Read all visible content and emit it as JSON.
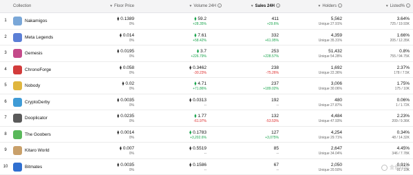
{
  "header": {
    "collection": "Collection",
    "floor": "Floor Price",
    "volume": "Volume 24H",
    "sales": "Sales 24H",
    "holders": "Holders",
    "listed": "Listed%"
  },
  "rows": [
    {
      "rank": "1",
      "name": "Nakamigos",
      "avatar_color": "#7aa7d8",
      "floor": "0.1389",
      "floor_chg": "0%",
      "volume": "59.2",
      "volume_chg": "+28.35%",
      "volume_dir": "pos",
      "volume_eth_up": true,
      "sales": "411",
      "sales_chg": "+29.6%",
      "sales_dir": "pos",
      "holders": "5,562",
      "holders_unique": "Unique 27.91%",
      "listed": "3.64%",
      "listed_sub": "725 / 19.93K"
    },
    {
      "rank": "2",
      "name": "Meta Legends",
      "avatar_color": "#5b7fd6",
      "floor": "0.014",
      "floor_chg": "0%",
      "volume": "7.61",
      "volume_chg": "+58.42%",
      "volume_dir": "pos",
      "volume_eth_up": true,
      "sales": "332",
      "sales_chg": "+61.95%",
      "sales_dir": "pos",
      "holders": "4,359",
      "holders_unique": "Unique 35.31%",
      "listed": "1.66%",
      "listed_sub": "205 / 12.35K"
    },
    {
      "rank": "3",
      "name": "Gemesis",
      "avatar_color": "#c44a8a",
      "floor": "0.0195",
      "floor_chg": "0%",
      "volume": "3.7",
      "volume_chg": "+226.79%",
      "volume_dir": "pos",
      "volume_eth_up": true,
      "sales": "253",
      "sales_chg": "+228.57%",
      "sales_dir": "pos",
      "holders": "51,432",
      "holders_unique": "Unique 54.28%",
      "listed": "0.8%",
      "listed_sub": "755 / 94.75K"
    },
    {
      "rank": "4",
      "name": "ChronoForge",
      "avatar_color": "#d23b3b",
      "floor": "0.058",
      "floor_chg": "0%",
      "volume": "0.3462",
      "volume_chg": "-30.23%",
      "volume_dir": "neg",
      "volume_eth_up": false,
      "sales": "238",
      "sales_chg": "-75.26%",
      "sales_dir": "neg",
      "holders": "1,692",
      "holders_unique": "Unique 22.36%",
      "listed": "2.37%",
      "listed_sub": "178 / 7.5K"
    },
    {
      "rank": "5",
      "name": "Nobody",
      "avatar_color": "#e0b63e",
      "floor": "0.02",
      "floor_chg": "0%",
      "volume": "4.71",
      "volume_chg": "+71.86%",
      "volume_dir": "pos",
      "volume_eth_up": true,
      "sales": "237",
      "sales_chg": "+189.02%",
      "sales_dir": "pos",
      "holders": "3,006",
      "holders_unique": "Unique 30.06%",
      "listed": "1.75%",
      "listed_sub": "175 / 10K"
    },
    {
      "rank": "6",
      "name": "CryptoDerby",
      "avatar_color": "#3f9bd6",
      "floor": "0.0035",
      "floor_chg": "0%",
      "volume": "0.0313",
      "volume_chg": "--",
      "volume_dir": "neu",
      "volume_eth_up": false,
      "sales": "192",
      "sales_chg": "--",
      "sales_dir": "neu",
      "holders": "480",
      "holders_unique": "Unique 27.87%",
      "listed": "0.06%",
      "listed_sub": "1 / 1.72K"
    },
    {
      "rank": "7",
      "name": "Dooplicator",
      "avatar_color": "#5a5a5a",
      "floor": "0.0235",
      "floor_chg": "0%",
      "volume": "1.77",
      "volume_chg": "-61.97%",
      "volume_dir": "neg",
      "volume_eth_up": true,
      "sales": "132",
      "sales_chg": "-53.53%",
      "sales_dir": "neg",
      "holders": "4,484",
      "holders_unique": "Unique 47.93%",
      "listed": "2.23%",
      "listed_sub": "209 / 9.36K"
    },
    {
      "rank": "8",
      "name": "The Goobers",
      "avatar_color": "#59b85a",
      "floor": "0.0014",
      "floor_chg": "0%",
      "volume": "0.1783",
      "volume_chg": "+3,202.6%",
      "volume_dir": "pos",
      "volume_eth_up": true,
      "sales": "127",
      "sales_chg": "+3,075%",
      "sales_dir": "pos",
      "holders": "4,254",
      "holders_unique": "Unique 29.71%",
      "listed": "0.34%",
      "listed_sub": "48 / 14.32K"
    },
    {
      "rank": "9",
      "name": "Kitaro World",
      "avatar_color": "#c9a06a",
      "floor": "0.007",
      "floor_chg": "0%",
      "volume": "0.5519",
      "volume_chg": "--",
      "volume_dir": "neu",
      "volume_eth_up": false,
      "sales": "85",
      "sales_chg": "--",
      "sales_dir": "neu",
      "holders": "2,647",
      "holders_unique": "Unique 34.04%",
      "listed": "4.45%",
      "listed_sub": "346 / 7.78K"
    },
    {
      "rank": "10",
      "name": "Bitmates",
      "avatar_color": "#2f6fd0",
      "floor": "0.0035",
      "floor_chg": "0%",
      "volume": "0.1586",
      "volume_chg": "--",
      "volume_dir": "neu",
      "volume_eth_up": false,
      "sales": "67",
      "sales_chg": "--",
      "sales_dir": "neu",
      "holders": "2,050",
      "holders_unique": "Unique 20.50%",
      "listed": "0.91%",
      "listed_sub": "91 / 10K"
    }
  ],
  "watermark": "金色财经"
}
